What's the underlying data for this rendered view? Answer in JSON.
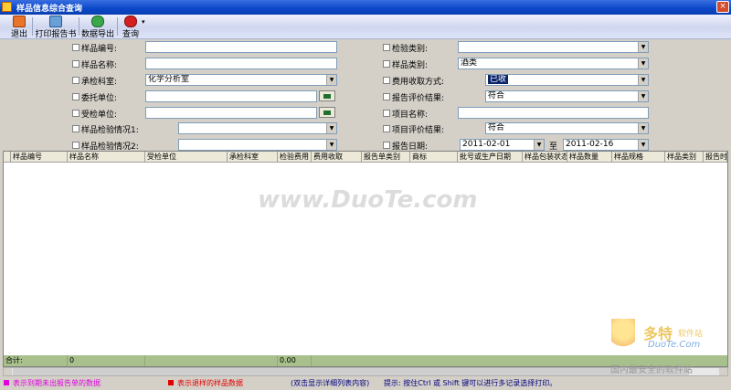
{
  "window": {
    "title": "样品信息综合查询",
    "close_label": "×"
  },
  "toolbar": {
    "exit": "退出",
    "print_report": "打印报告书",
    "export": "数据导出",
    "query": "查询",
    "dropdown_arrow": "▾"
  },
  "form": {
    "left": [
      {
        "label": "样品编号:",
        "value": ""
      },
      {
        "label": "样品名称:",
        "value": ""
      },
      {
        "label": "承检科室:",
        "value": "化学分析室"
      },
      {
        "label": "委托单位:",
        "value": ""
      },
      {
        "label": "受检单位:",
        "value": ""
      },
      {
        "label": "样品检验情况1:",
        "value": ""
      },
      {
        "label": "样品检验情况2:",
        "value": ""
      }
    ],
    "right": [
      {
        "label": "检验类别:",
        "value": ""
      },
      {
        "label": "样品类别:",
        "value": "酒类"
      },
      {
        "label": "费用收取方式:",
        "value": "已收"
      },
      {
        "label": "报告评价结果:",
        "value": "符合"
      },
      {
        "label": "项目名称:",
        "value": ""
      },
      {
        "label": "项目评价结果:",
        "value": "符合"
      },
      {
        "label": "报告日期:",
        "date_from": "2011-02-01",
        "to_label": "至",
        "date_to": "2011-02-16"
      }
    ],
    "dropdown_glyph": "▼"
  },
  "grid": {
    "columns": [
      "样品编号",
      "样品名称",
      "受检单位",
      "承检科室",
      "检验费用",
      "费用收取",
      "报告单类别",
      "商标",
      "批号或生产日期",
      "样品包装状态",
      "样品数量",
      "样品规格",
      "样品类别",
      "报告时"
    ],
    "footer": {
      "total_label": "合计:",
      "total_count": "0",
      "total_fee": "0.00"
    }
  },
  "watermark": {
    "text": "www.DuoTe.com",
    "logo_title": "多特",
    "logo_sub": "软件站",
    "logo_url": "DuoTe.Com",
    "logo_tag": "国内最安全的软件站"
  },
  "status": {
    "legend_pink": "表示到期未出报告单的数据",
    "legend_red": "表示退样的样品数据",
    "hint_dblclick": "(双击显示详细列表内容)",
    "hint_select": "提示: 按住Ctrl 或 Shift 键可以进行多记录选择打印。"
  },
  "colors": {
    "pink": "#e000e0",
    "red": "#e00000",
    "footer_green": "#a8c08c",
    "titlebar": "#0a46c8"
  }
}
